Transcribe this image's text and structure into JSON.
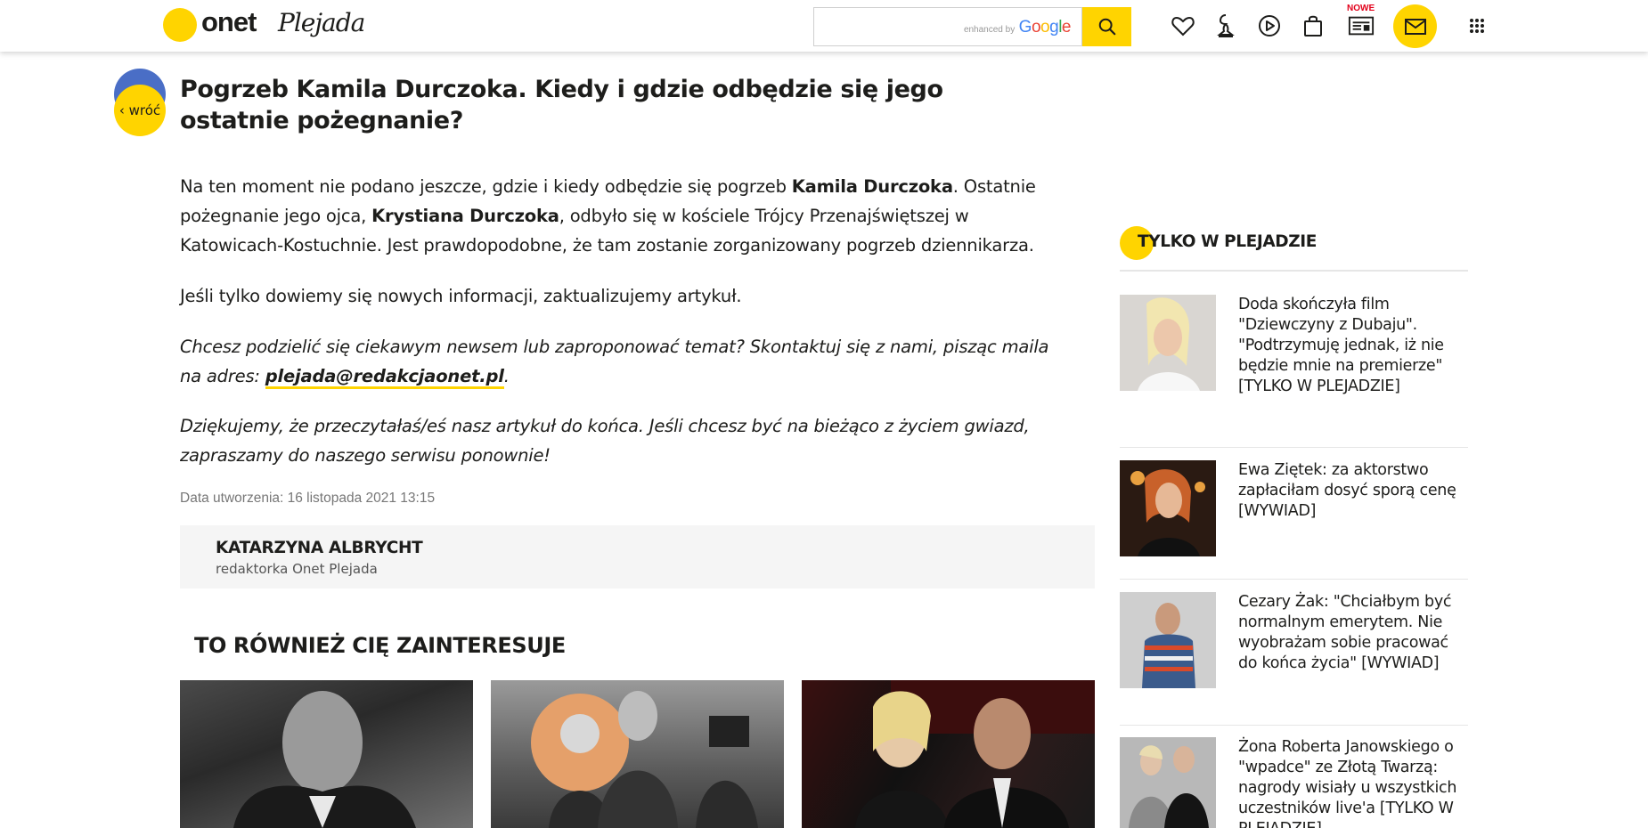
{
  "header": {
    "logo_text": "onet",
    "logo_script": "Plejada",
    "search": {
      "placeholder": "",
      "enhanced_by": "enhanced by",
      "provider": "Google"
    },
    "nowe_badge": "NOWE",
    "icons": [
      "heart-icon",
      "horoscope-icon",
      "play-icon",
      "shopping-bag-icon",
      "newspaper-icon",
      "mail-icon",
      "apps-grid-icon"
    ],
    "accent_color": "#ffd400"
  },
  "back": {
    "label": "‹ wróć"
  },
  "article": {
    "title": "Pogrzeb Kamila Durczoka. Kiedy i gdzie odbędzie się jego ostatnie pożegnanie?",
    "p1": {
      "a": "Na ten moment nie podano jeszcze, gdzie i kiedy odbędzie się pogrzeb ",
      "b": "Kamila Durczoka",
      "c": ". Ostatnie pożegnanie jego ojca, ",
      "d": "Krystiana Durczoka",
      "e": ", odbyło się w kościele Trójcy Przenajświętszej w Katowicach-Kostuchnie. Jest prawdopodobne, że tam zostanie zorganizowany pogrzeb dziennikarza."
    },
    "p2": "Jeśli tylko dowiemy się nowych informacji, zaktualizujemy artykuł.",
    "p3": {
      "a": "Chcesz podzielić się ciekawym newsem lub zaproponować temat? Skontaktuj się z nami, pisząc maila na adres: ",
      "email": "plejada@redakcjaonet.pl",
      "c": "."
    },
    "p4": "Dziękujemy, że przeczytałaś/eś nasz artykuł do końca. Jeśli chcesz być na bieżąco z życiem gwiazd, zapraszamy do naszego serwisu ponownie!",
    "created": "Data utworzenia: 16 listopada 2021 13:15",
    "author": {
      "name": "KATARZYNA ALBRYCHT",
      "role": "redaktorka Onet Plejada"
    }
  },
  "related": {
    "title": "TO RÓWNIEŻ CIĘ ZAINTERESUJE"
  },
  "sidebar": {
    "heading": "TYLKO W PLEJADZIE",
    "items": [
      {
        "text": "Doda skończyła film \"Dziewczyny z Dubaju\". \"Podtrzymuję jednak, iż nie będzie mnie na premierze\" [TYLKO W PLEJADZIE]"
      },
      {
        "text": "Ewa Ziętek: za aktorstwo zapłaciłam dosyć sporą cenę [WYWIAD]"
      },
      {
        "text": "Cezary Żak: \"Chciałbym być normalnym emerytem. Nie wyobrażam sobie pracować do końca życia\" [WYWIAD]"
      },
      {
        "text": "Żona Roberta Janowskiego o \"wpadce\" ze Złotą Twarzą: nagrody wisiały u wszystkich uczestników live'a [TYLKO W PLEJADZIE]"
      }
    ]
  }
}
